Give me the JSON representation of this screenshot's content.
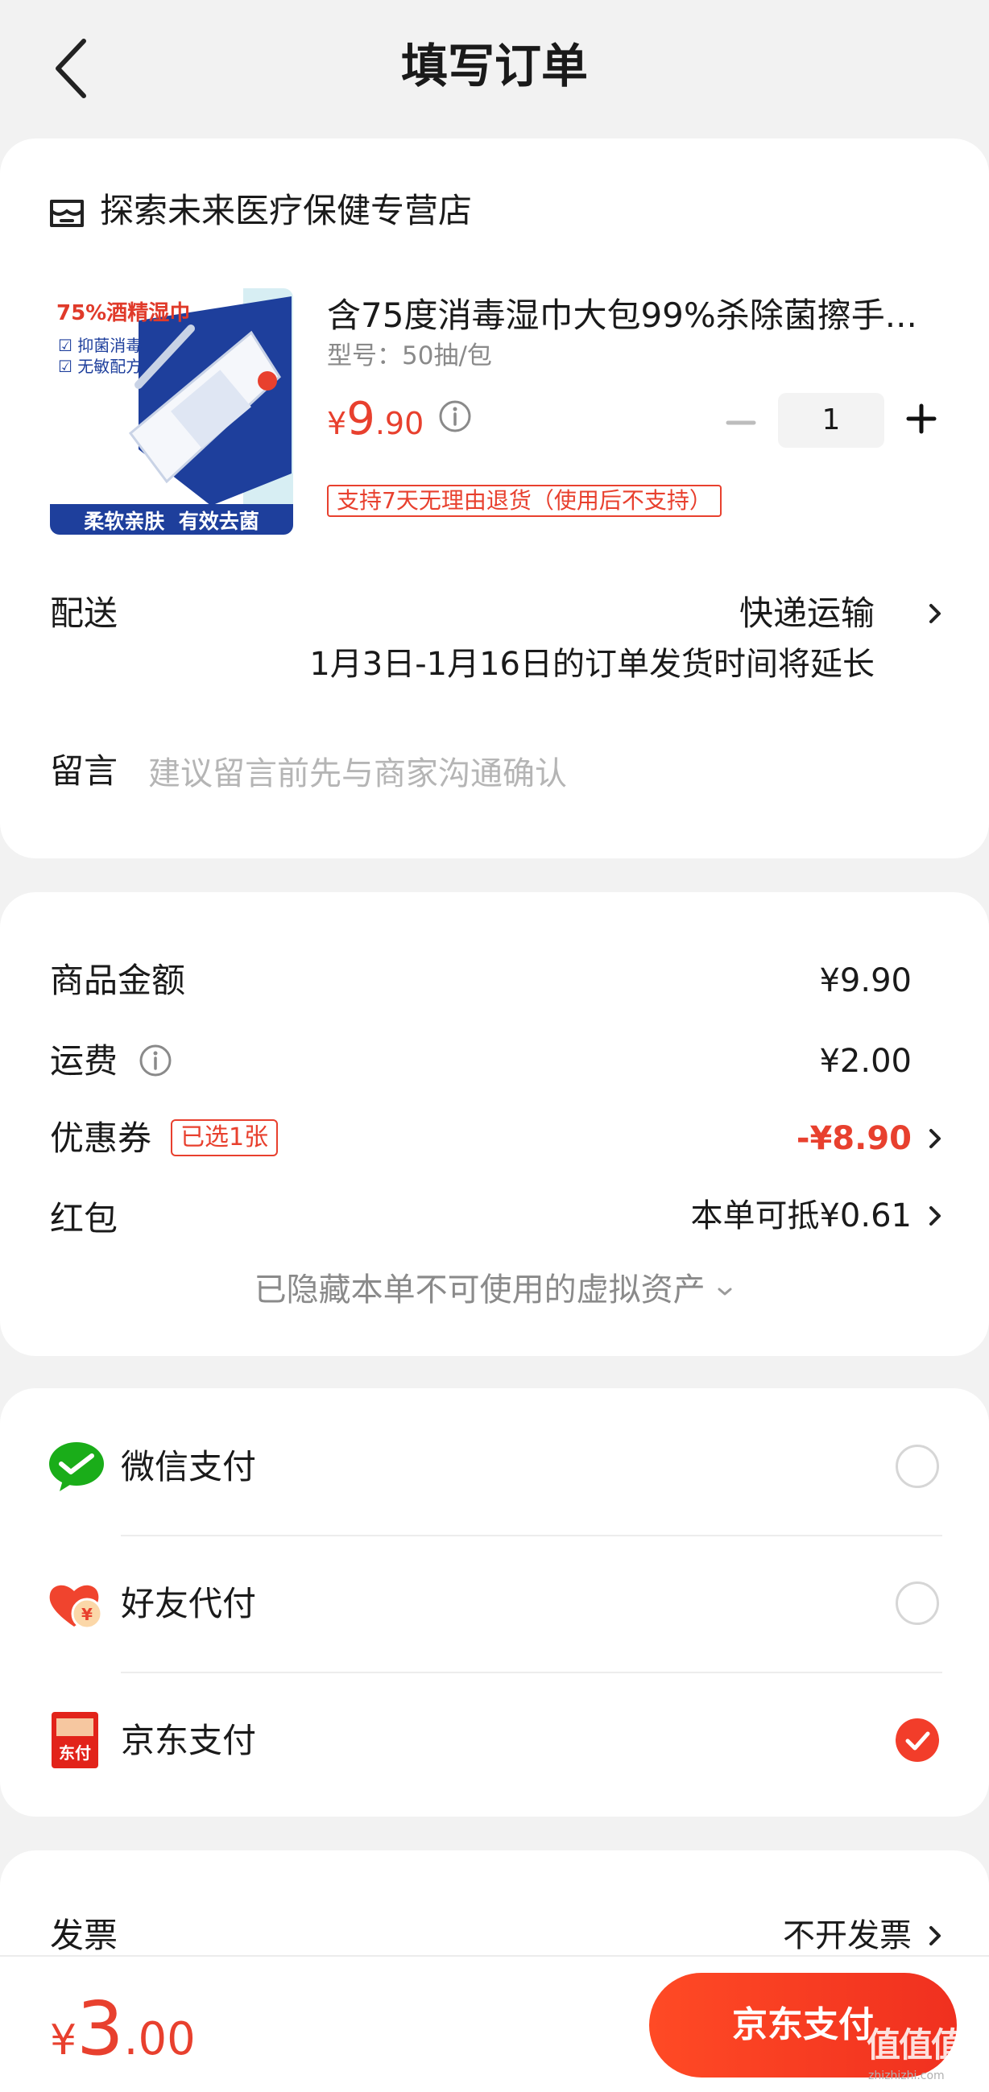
{
  "header": {
    "title": "填写订单"
  },
  "shop": {
    "name": "探索未来医疗保健专营店",
    "product": {
      "title": "含75度消毒湿巾大包99%杀除菌擦手...",
      "spec": "型号：50抽/包",
      "price_currency": "¥",
      "price_int": "9",
      "price_dec": ".90",
      "quantity": "1",
      "policy": "支持7天无理由退货（使用后不支持）",
      "image_text": {
        "top": "75%酒精湿巾",
        "tag1": "抑菌消毒",
        "tag2": "无敏配方",
        "bottom": "柔软亲肤  有效去菌"
      }
    },
    "delivery": {
      "label": "配送",
      "value": "快递运输",
      "note": "1月3日-1月16日的订单发货时间将延长"
    },
    "note": {
      "label": "留言",
      "placeholder": "建议留言前先与商家沟通确认"
    }
  },
  "price": {
    "goods_label": "商品金额",
    "goods_value": "¥9.90",
    "shipping_label": "运费",
    "shipping_value": "¥2.00",
    "coupon_label": "优惠券",
    "coupon_badge": "已选1张",
    "coupon_value": "-¥8.90",
    "redpacket_label": "红包",
    "redpacket_value": "本单可抵¥0.61",
    "hidden_assets": "已隐藏本单不可使用的虚拟资产"
  },
  "payment": {
    "methods": [
      {
        "label": "微信支付",
        "selected": false,
        "icon": "wechat-pay-icon"
      },
      {
        "label": "好友代付",
        "selected": false,
        "icon": "friend-pay-icon"
      },
      {
        "label": "京东支付",
        "selected": true,
        "icon": "jd-pay-icon"
      }
    ]
  },
  "invoice": {
    "label": "发票",
    "value": "不开发票"
  },
  "bottom": {
    "total_currency": "¥",
    "total_int": "3",
    "total_dec": ".00",
    "pay_button": "京东支付",
    "watermark": "值值值",
    "watermark_url": "zhizhizhi.com"
  },
  "colors": {
    "accent": "#e8402e",
    "background": "#f2f2f2",
    "wechat_green": "#1aad19"
  }
}
